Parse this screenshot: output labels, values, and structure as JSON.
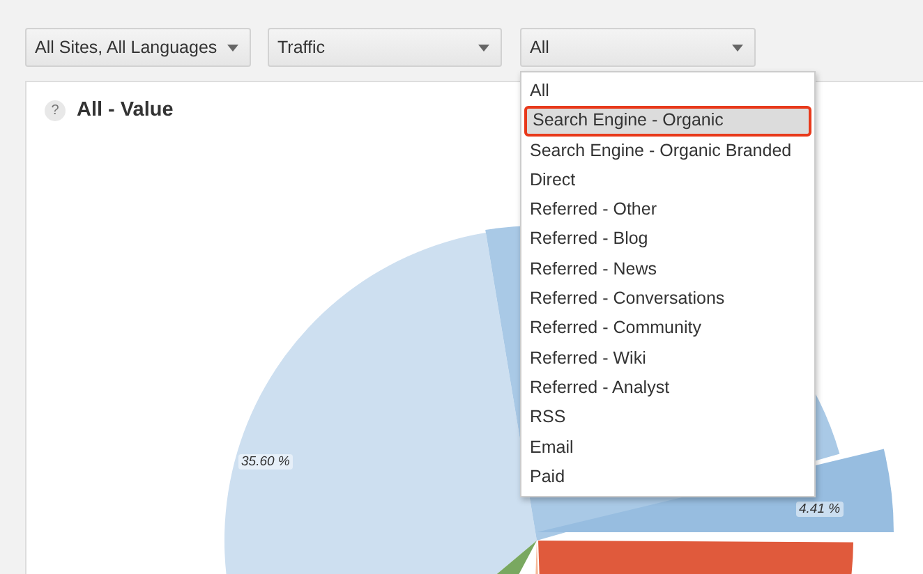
{
  "filters": [
    {
      "value": "All Sites, All Languages"
    },
    {
      "value": "Traffic"
    },
    {
      "value": "All"
    }
  ],
  "dropdown": {
    "items": [
      {
        "label": "All",
        "selected": false
      },
      {
        "label": "Search Engine - Organic",
        "selected": true
      },
      {
        "label": "Search Engine - Organic Branded",
        "selected": false
      },
      {
        "label": "Direct",
        "selected": false
      },
      {
        "label": "Referred - Other",
        "selected": false
      },
      {
        "label": "Referred - Blog",
        "selected": false
      },
      {
        "label": "Referred - News",
        "selected": false
      },
      {
        "label": "Referred - Conversations",
        "selected": false
      },
      {
        "label": "Referred - Community",
        "selected": false
      },
      {
        "label": "Referred - Wiki",
        "selected": false
      },
      {
        "label": "Referred - Analyst",
        "selected": false
      },
      {
        "label": "RSS",
        "selected": false
      },
      {
        "label": "Email",
        "selected": false
      },
      {
        "label": "Paid",
        "selected": false
      }
    ]
  },
  "panel": {
    "help": "?",
    "title": "All - Value",
    "slice_labels": [
      "35.60 %",
      "4.41 %"
    ]
  }
}
